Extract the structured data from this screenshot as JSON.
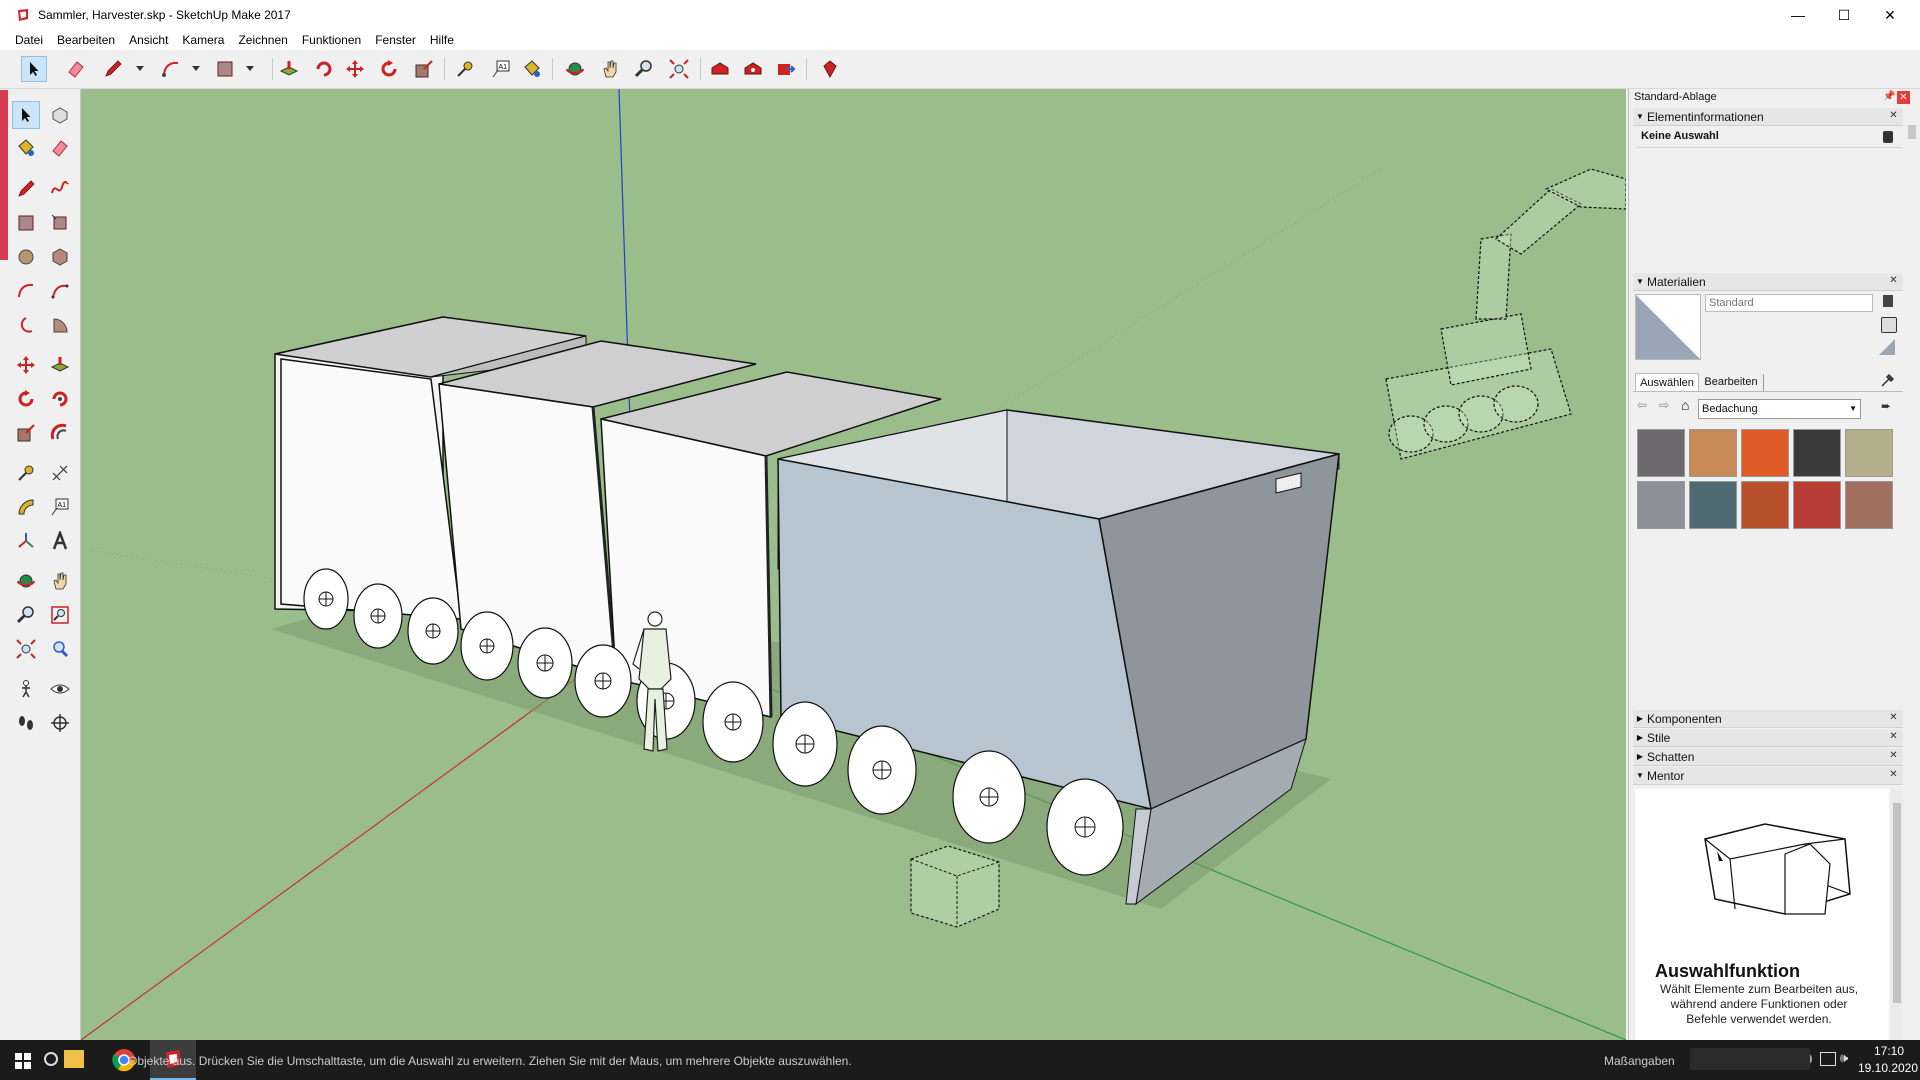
{
  "window": {
    "title": "Sammler, Harvester.skp - SketchUp Make 2017",
    "minimize_glyph": "—",
    "maximize_glyph": "☐",
    "close_glyph": "✕"
  },
  "menu": [
    "Datei",
    "Bearbeiten",
    "Ansicht",
    "Kamera",
    "Zeichnen",
    "Funktionen",
    "Fenster",
    "Hilfe"
  ],
  "tray": {
    "title": "Standard-Ablage",
    "entity_info": {
      "title": "Elementinformationen",
      "selection": "Keine Auswahl"
    },
    "materials": {
      "title": "Materialien",
      "name_placeholder": "Standard",
      "tab_select": "Auswählen",
      "tab_edit": "Bearbeiten",
      "library": "Bedachung",
      "swatches": [
        "#6c6a6c",
        "#c78a56",
        "#de5a26",
        "#3a3a3a",
        "#b5ae8a",
        "#8f8f96",
        "#4f6a72",
        "#b8502c",
        "#b53d33",
        "#a07060"
      ]
    },
    "collapsed_sections": [
      "Komponenten",
      "Stile",
      "Schatten"
    ],
    "mentor": {
      "title": "Mentor",
      "heading": "Auswahlfunktion",
      "text": "Wählt Elemente zum Bearbeiten aus, während andere Funktionen oder Befehle verwendet werden."
    }
  },
  "status": {
    "text": "Objekte aus. Drücken Sie die Umschalttaste, um die Auswahl zu erweitern. Ziehen Sie mit der Maus, um mehrere Objekte auszuwählen.",
    "measure_label": "Maßangaben"
  },
  "taskbar": {
    "time": "17:10",
    "date": "19.10.2020"
  },
  "colors": {
    "ground": "#9bbd8c",
    "accent": "#d63c52",
    "selection": "#cce4f7"
  }
}
